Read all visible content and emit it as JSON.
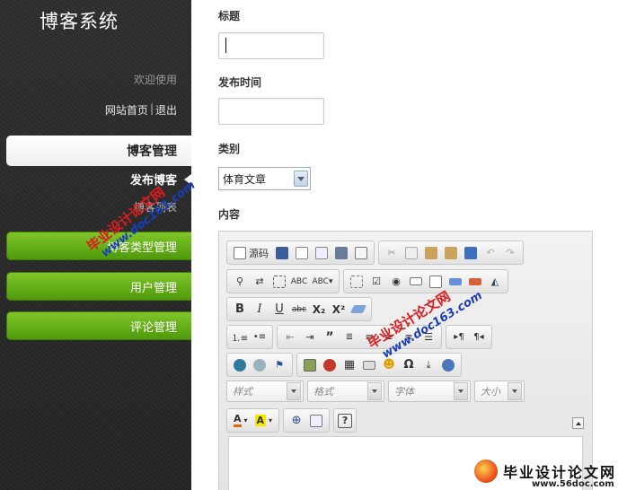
{
  "sidebar": {
    "app_title": "博客系统",
    "welcome": "欢迎使用",
    "link_home": "网站首页",
    "link_sep": "|",
    "link_logout": "退出",
    "nav_active": "博客管理",
    "sub_publish": "发布博客",
    "sub_list": "博客列表",
    "nav_category": "博客类型管理",
    "nav_users": "用户管理",
    "nav_comments": "评论管理"
  },
  "form": {
    "title_label": "标题",
    "title_value": "",
    "time_label": "发布时间",
    "time_value": "",
    "category_label": "类别",
    "category_value": "体育文章",
    "content_label": "内容"
  },
  "editor": {
    "source_label": "源码",
    "style_placeholder": "样式",
    "format_placeholder": "格式",
    "font_placeholder": "字体",
    "size_placeholder": "大小",
    "bold": "B",
    "italic": "I",
    "underline": "U",
    "strike": "abc",
    "subscript": "X₂",
    "superscript": "X²",
    "help": "?",
    "text_color": "A",
    "bg_color": "A"
  },
  "watermark": {
    "red_text": "毕业设计论文网",
    "blue_text": "www.doc163.com",
    "logo_text": "毕业设计论文网",
    "logo_url": "www.56doc.com"
  },
  "colors": {
    "sidebar_bg": "#2b2b2b",
    "nav_green": "#5fa915",
    "watermark_red": "#e01b1b",
    "watermark_blue": "#1a3fb8"
  }
}
